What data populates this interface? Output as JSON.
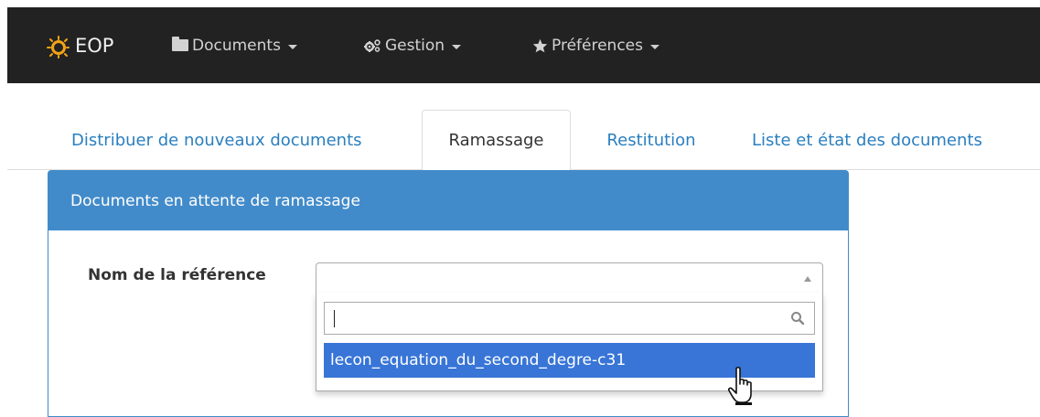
{
  "navbar": {
    "brand": "EOP",
    "menus": [
      {
        "label": "Documents",
        "icon": "folder-icon"
      },
      {
        "label": "Gestion",
        "icon": "gears-icon"
      },
      {
        "label": "Préférences",
        "icon": "star-icon"
      }
    ],
    "background": "#222222"
  },
  "tabs": [
    {
      "label": "Distribuer de nouveaux documents",
      "active": false
    },
    {
      "label": "Ramassage",
      "active": true
    },
    {
      "label": "Restitution",
      "active": false
    },
    {
      "label": "Liste et état des documents",
      "active": false
    }
  ],
  "panel": {
    "heading": "Documents en attente de ramassage",
    "heading_color": "#428bca",
    "field_label": "Nom de la référence",
    "select": {
      "value": "",
      "search_value": "",
      "results": [
        "lecon_equation_du_second_degre-c31"
      ],
      "highlight_color": "#3875d7"
    }
  }
}
